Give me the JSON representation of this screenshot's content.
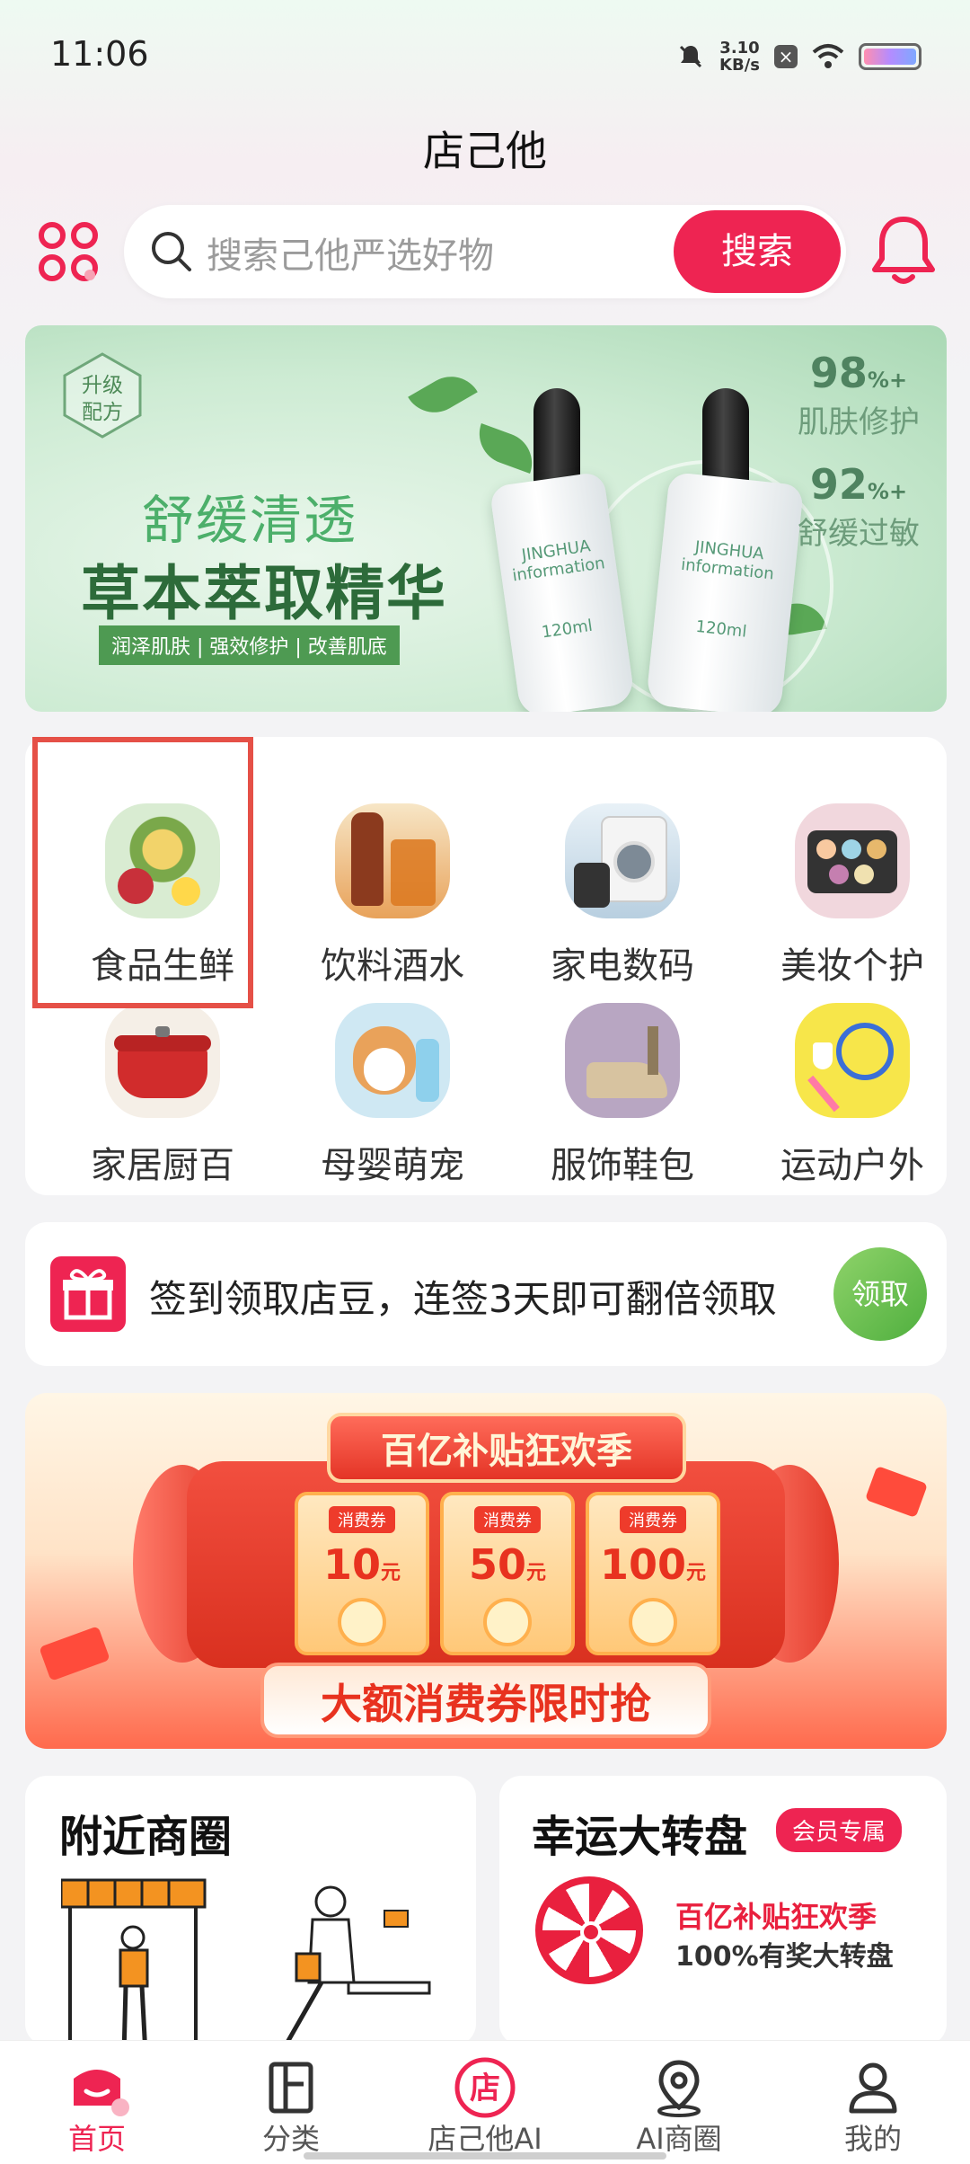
{
  "status": {
    "time": "11:06",
    "speed_value": "3.10",
    "speed_unit": "KB/s"
  },
  "app_title": "店己他",
  "search": {
    "placeholder": "搜索己他严选好物",
    "button": "搜索"
  },
  "banner": {
    "badge": [
      "升级",
      "配方"
    ],
    "subtitle": "舒缓清透",
    "title": "草本萃取精华",
    "tags": "润泽肌肤 | 强效修护 | 改善肌底",
    "stats": [
      {
        "value": "98",
        "unit": "%+",
        "label": "肌肤修护"
      },
      {
        "value": "92",
        "unit": "%+",
        "label": "舒缓过敏"
      }
    ],
    "bottle_brand": "JINGHUA",
    "bottle_text": "information",
    "bottle_volume": "120ml"
  },
  "categories": [
    {
      "label": "食品生鲜",
      "icon": "fruit-icon"
    },
    {
      "label": "饮料酒水",
      "icon": "drinks-icon"
    },
    {
      "label": "家电数码",
      "icon": "appliance-icon"
    },
    {
      "label": "美妆个护",
      "icon": "makeup-icon"
    },
    {
      "label": "家居厨百",
      "icon": "cookware-icon"
    },
    {
      "label": "母婴萌宠",
      "icon": "pet-icon"
    },
    {
      "label": "服饰鞋包",
      "icon": "shoe-icon"
    },
    {
      "label": "运动户外",
      "icon": "sports-icon"
    }
  ],
  "checkin": {
    "text": "签到领取店豆，连签3天即可翻倍领取",
    "button": "领取"
  },
  "promo": {
    "title": "百亿补贴狂欢季",
    "coupons": [
      {
        "tag": "消费券",
        "amount": "10",
        "unit": "元"
      },
      {
        "tag": "消费券",
        "amount": "50",
        "unit": "元"
      },
      {
        "tag": "消费券",
        "amount": "100",
        "unit": "元"
      }
    ],
    "bottom": "大额消费券限时抢"
  },
  "nearby": {
    "title": "附近商圈"
  },
  "lucky": {
    "title": "幸运大转盘",
    "badge": "会员专属",
    "line1": "百亿补贴狂欢季",
    "line2": "100%有奖大转盘"
  },
  "tabs": [
    {
      "label": "首页",
      "icon": "home-icon"
    },
    {
      "label": "分类",
      "icon": "category-icon"
    },
    {
      "label": "店己他AI",
      "icon": "store-ai-icon"
    },
    {
      "label": "AI商圈",
      "icon": "location-icon"
    },
    {
      "label": "我的",
      "icon": "profile-icon"
    }
  ],
  "colors": {
    "accent": "#ee2452",
    "green": "#4faf3e",
    "highlight_box": "#e55047"
  }
}
